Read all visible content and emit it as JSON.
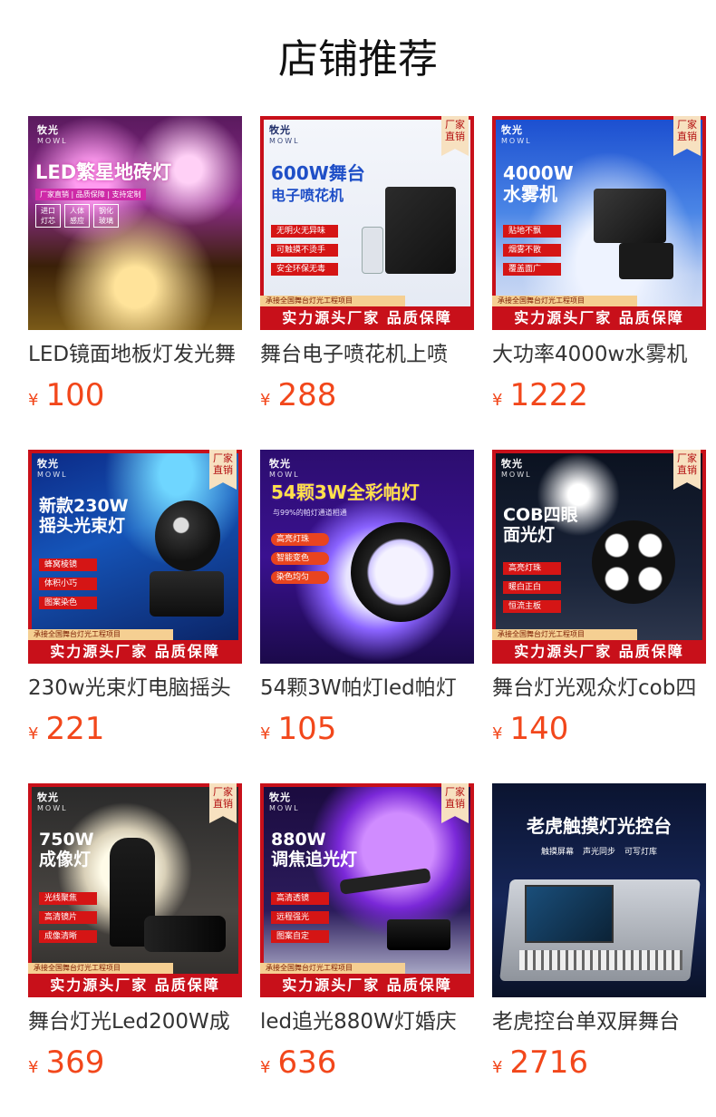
{
  "page": {
    "title": "店铺推荐"
  },
  "colors": {
    "price": "#f2471b",
    "ribbon_bg": "#f7e1c0",
    "bar_red": "#c8101a",
    "bullet_red": "#d51515"
  },
  "products": [
    {
      "name": "LED镜面地板灯发光舞",
      "currency": "¥",
      "price": "100",
      "image": {
        "brand": "牧光",
        "brand_en": "MOWL",
        "headline": "LED繁星地砖灯",
        "tagline": "厂家直销 | 品质保障 | 支持定制",
        "features": [
          "进口灯芯",
          "人体感应",
          "钢化玻璃"
        ]
      }
    },
    {
      "name": "舞台电子喷花机上喷",
      "currency": "¥",
      "price": "288",
      "image": {
        "brand": "牧光",
        "brand_en": "MOWL",
        "ribbon": "厂家直销",
        "headline_1": "600W舞台",
        "headline_2": "电子喷花机",
        "features": [
          "无明火无异味",
          "可触摸不烫手",
          "安全环保无毒"
        ],
        "strip_small": "承接全国舞台灯光工程项目",
        "strip_big": "实力源头厂家 品质保障"
      }
    },
    {
      "name": "大功率4000w水雾机",
      "currency": "¥",
      "price": "1222",
      "image": {
        "brand": "牧光",
        "brand_en": "MOWL",
        "ribbon": "厂家直销",
        "headline_1": "4000W",
        "headline_2": "水雾机",
        "features": [
          "贴地不飘",
          "烟雾不散",
          "覆盖面广"
        ],
        "strip_small": "承接全国舞台灯光工程项目",
        "strip_big": "实力源头厂家 品质保障"
      }
    },
    {
      "name": "230w光束灯电脑摇头",
      "currency": "¥",
      "price": "221",
      "image": {
        "brand": "牧光",
        "brand_en": "MOWL",
        "ribbon": "厂家直销",
        "headline_1": "新款230W",
        "headline_2": "摇头光束灯",
        "features": [
          "蜂窝棱镜",
          "体积小巧",
          "图案染色"
        ],
        "strip_small": "承接全国舞台灯光工程项目",
        "strip_big": "实力源头厂家 品质保障"
      }
    },
    {
      "name": "54颗3W帕灯led帕灯",
      "currency": "¥",
      "price": "105",
      "image": {
        "brand": "牧光",
        "brand_en": "MOWL",
        "headline_1": "54颗3W全彩帕灯",
        "tagline": "与99%的帕灯通道相通",
        "features": [
          "高亮灯珠",
          "智能变色",
          "染色均匀"
        ]
      }
    },
    {
      "name": "舞台灯光观众灯cob四",
      "currency": "¥",
      "price": "140",
      "image": {
        "brand": "牧光",
        "brand_en": "MOWL",
        "ribbon": "厂家直销",
        "headline_1": "COB四眼",
        "headline_2": "面光灯",
        "features": [
          "高亮灯珠",
          "暖白正白",
          "恒流主板"
        ],
        "strip_small": "承接全国舞台灯光工程项目",
        "strip_big": "实力源头厂家 品质保障"
      }
    },
    {
      "name": "舞台灯光Led200W成",
      "currency": "¥",
      "price": "369",
      "image": {
        "brand": "牧光",
        "brand_en": "MOWL",
        "ribbon": "厂家直销",
        "headline_1": "750W",
        "headline_2": "成像灯",
        "features": [
          "光线聚焦",
          "高清镜片",
          "成像清晰"
        ],
        "strip_small": "承接全国舞台灯光工程项目",
        "strip_big": "实力源头厂家 品质保障"
      }
    },
    {
      "name": "led追光880W灯婚庆",
      "currency": "¥",
      "price": "636",
      "image": {
        "brand": "牧光",
        "brand_en": "MOWL",
        "ribbon": "厂家直销",
        "headline_1": "880W",
        "headline_2": "调焦追光灯",
        "features": [
          "高清透镜",
          "远程强光",
          "图案自定"
        ],
        "strip_small": "承接全国舞台灯光工程项目",
        "strip_big": "实力源头厂家 品质保障"
      }
    },
    {
      "name": "老虎控台单双屏舞台",
      "currency": "¥",
      "price": "2716",
      "image": {
        "headline_1": "老虎触摸灯光控台",
        "features": [
          "触摸屏幕",
          "声光同步",
          "可写灯库"
        ]
      }
    }
  ]
}
